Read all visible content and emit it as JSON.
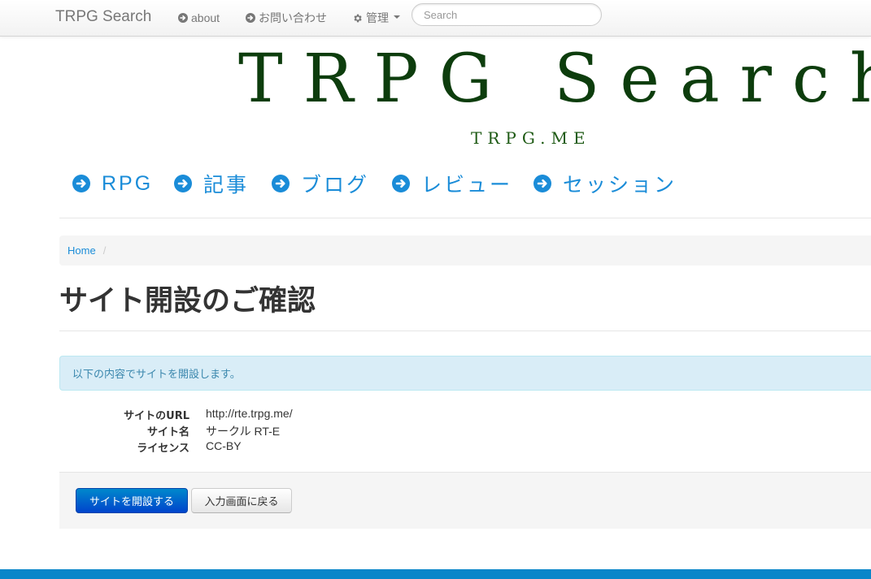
{
  "navbar": {
    "brand": "TRPG Search",
    "about": "about",
    "contact": "お問い合わせ",
    "admin": "管理",
    "search_placeholder": "Search"
  },
  "logo": {
    "title": "TRPG Search",
    "subtitle": "TRPG.ME"
  },
  "categories": [
    {
      "label": "RPG",
      "icon": "arrow-circle-right-icon"
    },
    {
      "label": "記事",
      "icon": "arrow-circle-right-icon"
    },
    {
      "label": "ブログ",
      "icon": "arrow-circle-right-icon"
    },
    {
      "label": "レビュー",
      "icon": "arrow-circle-right-icon"
    },
    {
      "label": "セッション",
      "icon": "arrow-circle-right-icon"
    }
  ],
  "breadcrumb": {
    "home": "Home",
    "separator": "/"
  },
  "page_title": "サイト開設のご確認",
  "alert": "以下の内容でサイトを開設します。",
  "details": [
    {
      "label": "サイトのURL",
      "value": "http://rte.trpg.me/"
    },
    {
      "label": "サイト名",
      "value": "サークル RT-E"
    },
    {
      "label": "ライセンス",
      "value": "CC-BY"
    }
  ],
  "actions": {
    "submit": "サイトを開設する",
    "back": "入力画面に戻る"
  },
  "colors": {
    "accent": "#1a8cd8",
    "logo": "#0d3d0d",
    "primary_button": "#0066cc",
    "footer": "#0a86c9",
    "alert_bg": "#d9edf7"
  }
}
